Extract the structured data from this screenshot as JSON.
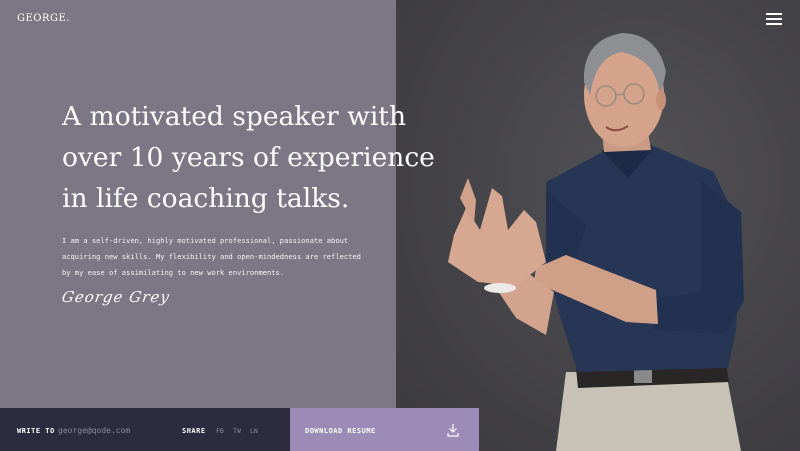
{
  "header": {
    "logo": "GEORGE."
  },
  "hero": {
    "headline": "A motivated speaker with over 10 years of experience in life coaching talks.",
    "bio": "I am a self-driven, highly motivated professional, passionate about acquiring new skills. My flexibility and open-mindedness are reflected by my ease of assimilating to new work environments.",
    "signature": "George Grey"
  },
  "footer": {
    "write_label": "WRITE TO",
    "email": "george@qode.com",
    "share_label": "SHARE",
    "social": [
      "FB",
      "TW",
      "LN"
    ],
    "download_label": "DOWNLOAD RESUME"
  },
  "colors": {
    "left_panel": "#7b7784",
    "footer_dark": "#2d2b40",
    "accent": "#9c8bb6"
  },
  "icons": {
    "menu": "hamburger-menu-icon",
    "download": "download-icon"
  }
}
